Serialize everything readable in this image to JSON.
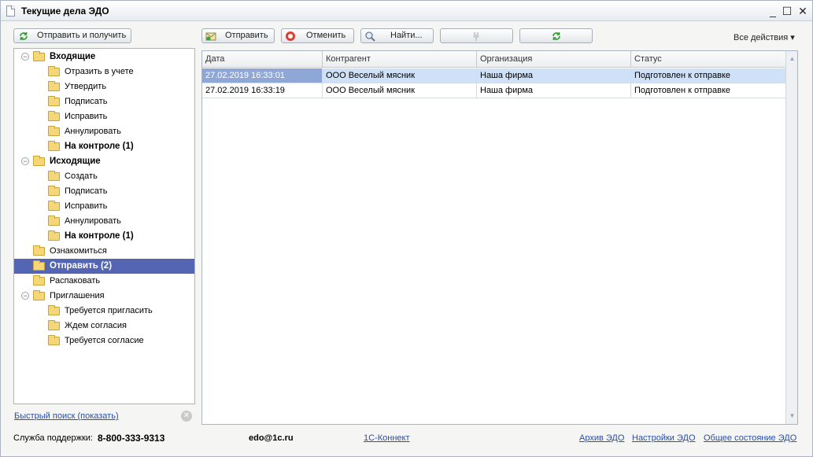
{
  "window": {
    "title": "Текущие дела ЭДО",
    "minimize": "_",
    "maximize": "☐",
    "close": "✕"
  },
  "left_toolbar": {
    "send_receive": "Отправить и получить"
  },
  "toolbar": {
    "send": "Отправить",
    "cancel": "Отменить",
    "find": "Найти...",
    "all_actions": "Все действия ▾"
  },
  "tree": [
    {
      "label": "Входящие",
      "bold": true,
      "level": 0,
      "expander": "⊖"
    },
    {
      "label": "Отразить в учете",
      "bold": false,
      "level": 1
    },
    {
      "label": "Утвердить",
      "bold": false,
      "level": 1
    },
    {
      "label": "Подписать",
      "bold": false,
      "level": 1
    },
    {
      "label": "Исправить",
      "bold": false,
      "level": 1
    },
    {
      "label": "Аннулировать",
      "bold": false,
      "level": 1
    },
    {
      "label": "На контроле (1)",
      "bold": true,
      "level": 1
    },
    {
      "label": "Исходящие",
      "bold": true,
      "level": 0,
      "expander": "⊖"
    },
    {
      "label": "Создать",
      "bold": false,
      "level": 1
    },
    {
      "label": "Подписать",
      "bold": false,
      "level": 1
    },
    {
      "label": "Исправить",
      "bold": false,
      "level": 1
    },
    {
      "label": "Аннулировать",
      "bold": false,
      "level": 1
    },
    {
      "label": "На контроле (1)",
      "bold": true,
      "level": 1
    },
    {
      "label": "Ознакомиться",
      "bold": false,
      "level": 0
    },
    {
      "label": "Отправить (2)",
      "bold": true,
      "level": 0,
      "selected": true
    },
    {
      "label": "Распаковать",
      "bold": false,
      "level": 0
    },
    {
      "label": "Приглашения",
      "bold": false,
      "level": 0,
      "expander": "⊖"
    },
    {
      "label": "Требуется пригласить",
      "bold": false,
      "level": 1
    },
    {
      "label": "Ждем согласия",
      "bold": false,
      "level": 1
    },
    {
      "label": "Требуется согласие",
      "bold": false,
      "level": 1
    }
  ],
  "quick_search": "Быстрый поиск (показать)",
  "grid": {
    "columns": [
      "Дата",
      "Контрагент",
      "Организация",
      "Статус"
    ],
    "rows": [
      [
        "27.02.2019 16:33:01",
        "ООО Веселый мясник",
        "Наша фирма",
        "Подготовлен к отправке"
      ],
      [
        "27.02.2019 16:33:19",
        "ООО Веселый мясник",
        "Наша фирма",
        "Подготовлен к отправке"
      ]
    ]
  },
  "status_bar": {
    "support_label": "Служба поддержки:",
    "support_phone": "8-800-333-9313",
    "email": "edo@1c.ru",
    "connect": "1С-Коннект",
    "archive": "Архив ЭДО",
    "settings": "Настройки ЭДО",
    "overall": "Общее состояние ЭДО"
  },
  "colors": {
    "selection": "#5466b3",
    "row_selected": "#cfe1f7",
    "link": "#2a4fa8"
  }
}
